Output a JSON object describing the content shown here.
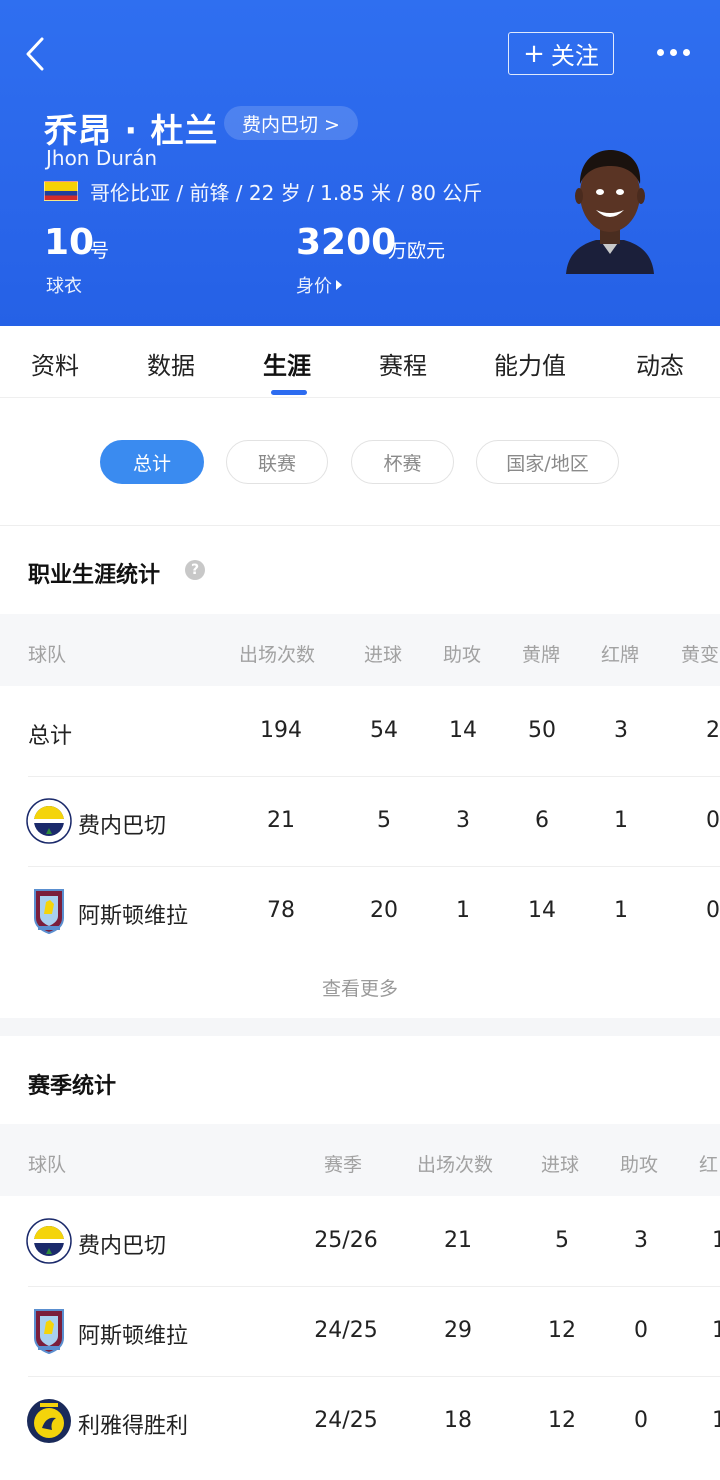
{
  "header": {
    "follow_label": "关注",
    "follow_plus": "+",
    "name_cn": "乔昂 · 杜兰",
    "club_chip": "费内巴切 >",
    "name_en": "Jhon Durán",
    "profile_line": "哥伦比亚 / 前锋 / 22 岁 / 1.85 米 / 80 公斤",
    "jersey_number": "10",
    "jersey_unit": "号",
    "jersey_label": "球衣",
    "market_value": "3200",
    "market_value_unit": "万欧元",
    "market_value_label": "身价",
    "colors": {
      "header_bg": "#2a66ea",
      "accent": "#2d6cf0",
      "chip_active": "#3a8bf0"
    }
  },
  "tabs": [
    "资料",
    "数据",
    "生涯",
    "赛程",
    "能力值",
    "动态"
  ],
  "active_tab": "生涯",
  "filters": [
    "总计",
    "联赛",
    "杯赛",
    "国家/地区"
  ],
  "active_filter": "总计",
  "career": {
    "title": "职业生涯统计",
    "help_icon": "?",
    "columns": [
      "球队",
      "出场次数",
      "进球",
      "助攻",
      "黄牌",
      "红牌",
      "黄变"
    ],
    "rows": [
      {
        "team": "总计",
        "apps": "194",
        "goals": "54",
        "assists": "14",
        "yellow": "50",
        "red": "3",
        "second_yellow": "2"
      },
      {
        "team": "费内巴切",
        "apps": "21",
        "goals": "5",
        "assists": "3",
        "yellow": "6",
        "red": "1",
        "second_yellow": "0",
        "badge": "fenerbahce-badge"
      },
      {
        "team": "阿斯顿维拉",
        "apps": "78",
        "goals": "20",
        "assists": "1",
        "yellow": "14",
        "red": "1",
        "second_yellow": "0",
        "badge": "aston-villa-badge"
      }
    ],
    "see_more": "查看更多"
  },
  "season": {
    "title": "赛季统计",
    "columns": [
      "球队",
      "赛季",
      "出场次数",
      "进球",
      "助攻",
      "红"
    ],
    "rows": [
      {
        "team": "费内巴切",
        "season": "25/26",
        "apps": "21",
        "goals": "5",
        "assists": "3",
        "extra": "1",
        "badge": "fenerbahce-badge"
      },
      {
        "team": "阿斯顿维拉",
        "season": "24/25",
        "apps": "29",
        "goals": "12",
        "assists": "0",
        "extra": "1",
        "badge": "aston-villa-badge"
      },
      {
        "team": "利雅得胜利",
        "season": "24/25",
        "apps": "18",
        "goals": "12",
        "assists": "0",
        "extra": "1",
        "badge": "al-nassr-badge"
      }
    ]
  }
}
